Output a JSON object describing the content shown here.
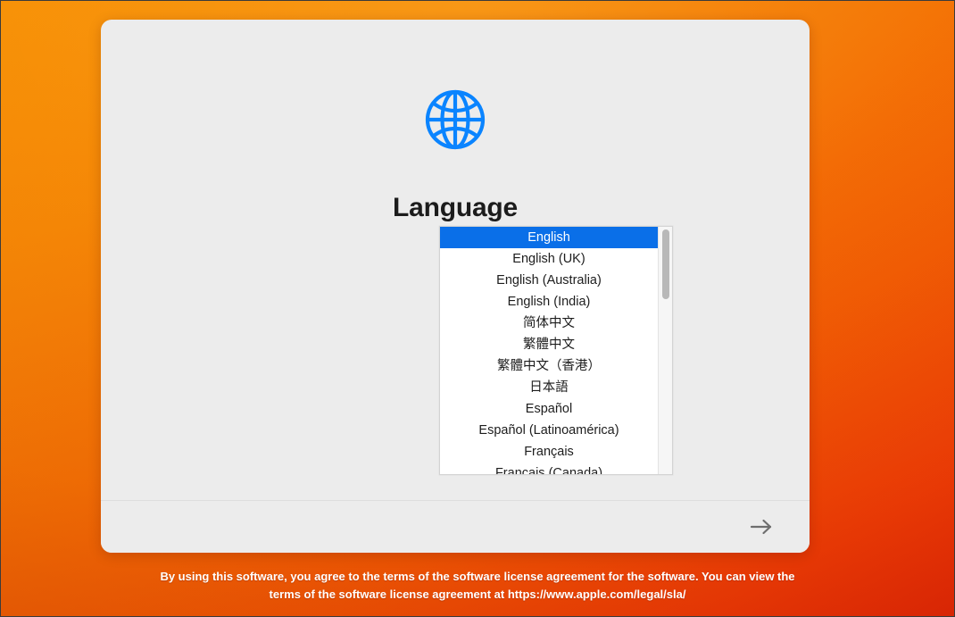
{
  "window": {
    "title": "Language",
    "icon": "globe-icon",
    "icon_color": "#0A84FF",
    "panel_background": "#ECECEC",
    "accent_color": "#0A6FE8"
  },
  "background": {
    "gradient_from": "#F79207",
    "gradient_to": "#E42B06"
  },
  "language_list": {
    "selected_index": 0,
    "items": [
      "English",
      "English (UK)",
      "English (Australia)",
      "English (India)",
      "简体中文",
      "繁體中文",
      "繁體中文（香港）",
      "日本語",
      "Español",
      "Español (Latinoamérica)",
      "Français",
      "Français (Canada)"
    ]
  },
  "footer": {
    "continue_label": "→",
    "continue_icon": "arrow-right-icon"
  },
  "license": {
    "line1": "By using this software, you agree to the terms of the software license agreement for the software. You can view the",
    "line2": "terms of the software license agreement at https://www.apple.com/legal/sla/"
  }
}
